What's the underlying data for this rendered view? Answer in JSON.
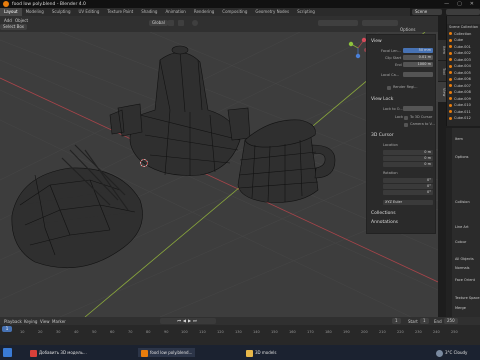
{
  "window": {
    "title": "food low poly.blend - Blender 4.0",
    "controls": [
      "—",
      "▢",
      "✕"
    ]
  },
  "workspace_tabs": [
    "Layout",
    "Modeling",
    "Sculpting",
    "UV Editing",
    "Texture Paint",
    "Shading",
    "Animation",
    "Rendering",
    "Compositing",
    "Geometry Nodes",
    "Scripting"
  ],
  "scene_name": "Scene",
  "viewport_header": {
    "menus": [
      "Add",
      "Object"
    ],
    "select_box": "Select Box",
    "transform": "Global",
    "options_label": "Options"
  },
  "npanel": {
    "view_section": "View",
    "focal_length_label": "Focal Len...",
    "focal_length_value": "50 mm",
    "clip_start_label": "Clip Start",
    "clip_start_value": "0.01 m",
    "end_label": "End",
    "end_value": "1000 m",
    "local_camera_label": "Local Ca...",
    "render_region_label": "Render Regi...",
    "view_lock_section": "View Lock",
    "lock_to_object_label": "Lock to O...",
    "lock_label": "Lock",
    "to_3d_cursor_label": "To 3D Cursor",
    "camera_to_view_label": "Camera to V...",
    "cursor_section": "3D Cursor",
    "location_label": "Location",
    "loc_x_label": "X",
    "loc_x_value": "0 m",
    "loc_y_label": "Y",
    "loc_y_value": "0 m",
    "loc_z_label": "Z",
    "loc_z_value": "0 m",
    "rotation_label": "Rotation",
    "rot_x_label": "X",
    "rot_x_value": "0°",
    "rot_y_label": "Y",
    "rot_y_value": "0°",
    "rot_z_label": "Z",
    "rot_z_value": "0°",
    "rotation_mode": "XYZ Euler",
    "collections_section": "Collections",
    "annotations_section": "Annotations",
    "tabs": [
      "Item",
      "Tool",
      "View"
    ]
  },
  "outliner": {
    "rows": [
      "Scene Collection",
      "Collection",
      "Cube",
      "Cube.001",
      "Cube.002",
      "Cube.003",
      "Cube.004",
      "Cube.005",
      "Cube.006",
      "Cube.007",
      "Cube.008",
      "Cube.009",
      "Cube.010",
      "Cube.011",
      "Cube.012"
    ]
  },
  "properties": {
    "rows": [
      "Item",
      "Options",
      "Collision",
      "Line Art",
      "Colour",
      "All Objects",
      "Normals",
      "Face Orient",
      "Texture Space",
      "Merge"
    ]
  },
  "timeline": {
    "menus": [
      "Playback",
      "Keying",
      "View",
      "Marker"
    ],
    "current_frame": "1",
    "start_label": "Start",
    "start_value": "1",
    "end_label": "End",
    "end_value": "250",
    "ticks": [
      "10",
      "20",
      "30",
      "40",
      "50",
      "60",
      "70",
      "80",
      "90",
      "100",
      "110",
      "120",
      "130",
      "140",
      "150",
      "160",
      "170",
      "180",
      "190",
      "200",
      "210",
      "220",
      "230",
      "240",
      "250"
    ]
  },
  "taskbar": {
    "items": [
      "Добавить 3D модель...",
      "food low poly.blend...",
      "3D models"
    ],
    "weather": "3°C Cloudy"
  },
  "colors": {
    "accent_blue": "#4772b3",
    "blender_orange": "#e87d0d",
    "x_axis_red": "#a8444a",
    "y_axis_green": "#8aa83c"
  }
}
